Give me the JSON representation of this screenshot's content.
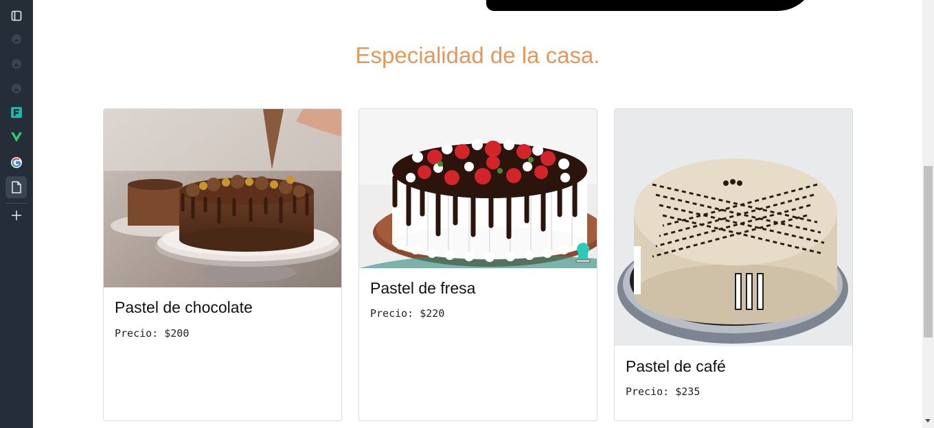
{
  "sidebar": {
    "items": [
      {
        "name": "panel-toggle-icon"
      },
      {
        "name": "github-icon-1"
      },
      {
        "name": "github-icon-2"
      },
      {
        "name": "github-icon-3"
      },
      {
        "name": "app-f-icon"
      },
      {
        "name": "vue-icon"
      },
      {
        "name": "google-icon"
      },
      {
        "name": "document-icon",
        "active": true
      },
      {
        "name": "add-icon"
      }
    ]
  },
  "section": {
    "title": "Especialidad de la casa."
  },
  "cards": [
    {
      "title": "Pastel de chocolate",
      "price": "Precio: $200"
    },
    {
      "title": "Pastel de fresa",
      "price": "Precio: $220"
    },
    {
      "title": "Pastel de café",
      "price": "Precio: $235"
    }
  ],
  "colors": {
    "sidebar_bg": "#252e38",
    "title_accent": "#e4975a"
  }
}
